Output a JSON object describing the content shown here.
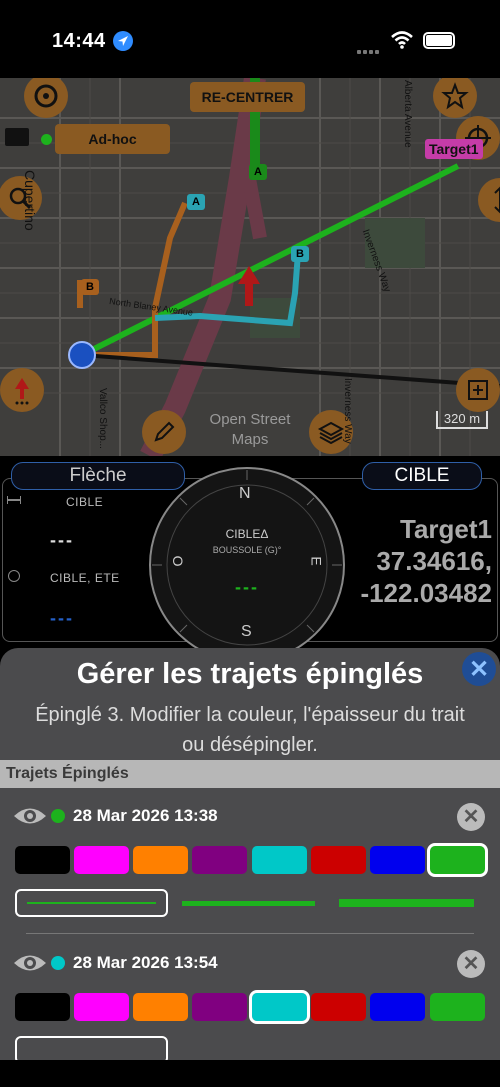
{
  "status": {
    "time": "14:44"
  },
  "map": {
    "recenter_label": "RE-CENTRER",
    "route_label": "Ad-hoc",
    "target_label": "Target1",
    "street_cupertino": "Cupertino",
    "street_alberta": "Alberta Avenue",
    "street_inverness": "Inverness Way",
    "street_north_blaney": "North Blaney Avenue",
    "street_inverness_2": "Inverness Way",
    "street_vallco": "Vallco Shop...",
    "osm_label": "Open Street Maps",
    "scale_label": "320 m",
    "pin_a1": "A",
    "pin_a2": "A",
    "pin_b1": "B",
    "pin_b2": "B"
  },
  "compass": {
    "tab_left": "Flèche",
    "tab_right": "CIBLE",
    "label_cible": "CIBLE",
    "value_cible": "---",
    "label_cible_ete": "CIBLE, ETE",
    "value_cible_ete": "---",
    "dial_title": "CIBLEΔ",
    "dial_subtitle": "BOUSSOLE (G)°",
    "dial_value": "---",
    "n": "N",
    "s": "S",
    "e": "E",
    "o": "O",
    "target_name": "Target1",
    "target_lat": "37.34616,",
    "target_lon": "-122.03482"
  },
  "sheet": {
    "title": "Gérer les trajets épinglés",
    "subtitle": "Épinglé 3. Modifier la couleur, l'épaisseur du trait ou désépingler.",
    "section_header": "Trajets Épinglés",
    "close_label": "✕",
    "trajets": [
      {
        "date": "28 Mar 2026 13:38",
        "dot_color": "#1db21d",
        "selected_color": 7,
        "selected_width": 0
      },
      {
        "date": "28 Mar 2026 13:54",
        "dot_color": "#00c8c8",
        "selected_color": 4,
        "selected_width": 0
      }
    ],
    "palette": [
      "#000000",
      "#ff00ff",
      "#ff8000",
      "#800080",
      "#00c8c8",
      "#cc0000",
      "#0000ee",
      "#1db21d"
    ],
    "remove_label": "✕"
  }
}
